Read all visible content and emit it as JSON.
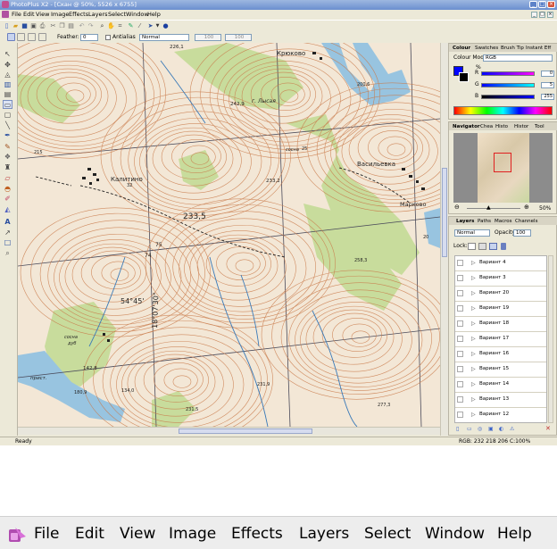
{
  "window": {
    "title": "PhotoPlus X2 - [Скан @ 50%, 5526 x 6755]",
    "controls": [
      "_",
      "□",
      "×"
    ]
  },
  "menu": [
    "File",
    "Edit",
    "View",
    "Image",
    "Effects",
    "Layers",
    "Select",
    "Window",
    "Help"
  ],
  "options_bar": {
    "feather_label": "Feather:",
    "feather_value": "0",
    "antialias_label": "Antialias",
    "mode_value": "Normal",
    "val1": "100",
    "val2": "100"
  },
  "map": {
    "labels": {
      "krjukovo": "Крюково",
      "lysaya": "г. Лысая",
      "kalitino": "Калитино",
      "vasilevka": "Васильевка",
      "markovo": "Марково",
      "elev_2335": "233,5",
      "elev_2332": "233,2",
      "elev_2429": "242,9",
      "elev_2261": "226,1",
      "elev_2006": "200,6",
      "elev_2583": "258,3",
      "elev_2319": "231,9",
      "elev_2315": "231,5",
      "elev_2773": "277,3",
      "elev_1428": "142,8",
      "elev_1240": "134,0",
      "elev_215": "215",
      "elev_1809": "180,9",
      "lat": "54°45'",
      "lon": "18°07'30\"",
      "sosna1": "сосна",
      "dub": "дуб",
      "pristan": "прист.",
      "num_74": "74",
      "num_75": "75",
      "num_32": "32",
      "num_18": "18",
      "num_25": "25",
      "num_20": "20"
    }
  },
  "colour_panel": {
    "tabs": [
      "Colour",
      "Swatches",
      "Brush Tip",
      "Instant Eff"
    ],
    "mode_label": "Colour Mode:",
    "mode_value": "RGB",
    "r_label": "R",
    "g_label": "G",
    "b_label": "B",
    "r_value": "0",
    "g_value": "5",
    "b_value": "255",
    "pct": "%"
  },
  "navigator_panel": {
    "tabs": [
      "Navigator",
      "Chea",
      "Histo",
      "Histor",
      "Tool"
    ],
    "zoom": "50%"
  },
  "layers_panel": {
    "tabs": [
      "Layers",
      "Paths",
      "Macros",
      "Channels"
    ],
    "blend": "Normal",
    "opacity_label": "Opacity:",
    "opacity_value": "100",
    "lock_label": "Lock:",
    "layers": [
      "Вариант 4",
      "Вариант 3",
      "Вариант 20",
      "Вариант 19",
      "Вариант 18",
      "Вариант 17",
      "Вариант 16",
      "Вариант 15",
      "Вариант 14",
      "Вариант 13",
      "Вариант 12"
    ]
  },
  "status": {
    "left": "Ready",
    "right": "RGB: 232 218 206 C:100%"
  },
  "zoomed_menu": {
    "items": [
      "File",
      "Edit",
      "View",
      "Image",
      "Effects",
      "Layers",
      "Select",
      "Window",
      "Help"
    ]
  }
}
